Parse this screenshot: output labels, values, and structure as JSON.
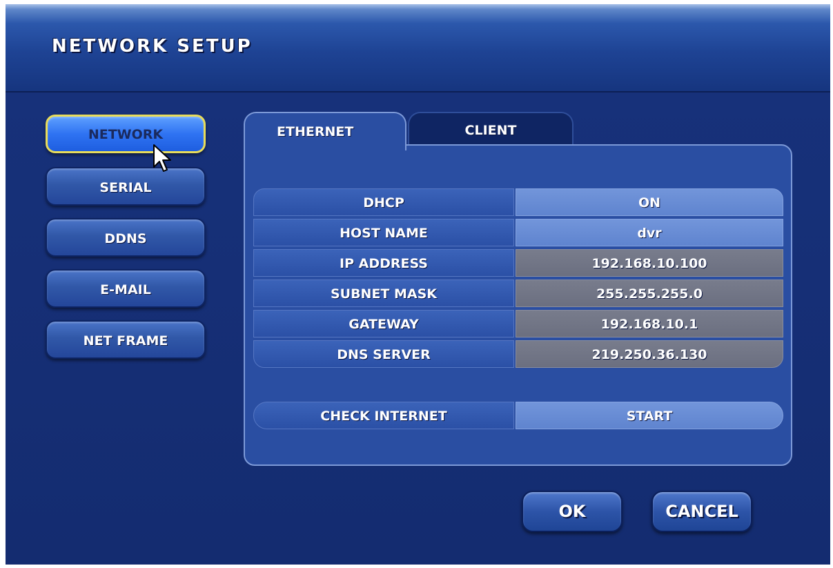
{
  "window": {
    "title": "NETWORK SETUP"
  },
  "sidebar": {
    "items": [
      {
        "label": "NETWORK",
        "active": true
      },
      {
        "label": "SERIAL",
        "active": false
      },
      {
        "label": "DDNS",
        "active": false
      },
      {
        "label": "E-MAIL",
        "active": false
      },
      {
        "label": "NET FRAME",
        "active": false
      }
    ]
  },
  "tabs": [
    {
      "label": "ETHERNET",
      "active": true
    },
    {
      "label": "CLIENT",
      "active": false
    }
  ],
  "settings": {
    "rows": [
      {
        "label": "DHCP",
        "value": "ON",
        "editable": true
      },
      {
        "label": "HOST NAME",
        "value": "dvr",
        "editable": true
      },
      {
        "label": "IP ADDRESS",
        "value": "192.168.10.100",
        "editable": false
      },
      {
        "label": "SUBNET MASK",
        "value": "255.255.255.0",
        "editable": false
      },
      {
        "label": "GATEWAY",
        "value": "192.168.10.1",
        "editable": false
      },
      {
        "label": "DNS SERVER",
        "value": "219.250.36.130",
        "editable": false
      }
    ]
  },
  "check_internet": {
    "label": "CHECK INTERNET",
    "button": "START"
  },
  "actions": {
    "ok": "OK",
    "cancel": "CANCEL"
  },
  "colors": {
    "background": "#17327c",
    "active_highlight": "#e8dc5a",
    "editable_cell": "#6b8ed5",
    "readonly_cell": "#737787"
  },
  "icons": {
    "cursor": "mouse-pointer-icon"
  }
}
